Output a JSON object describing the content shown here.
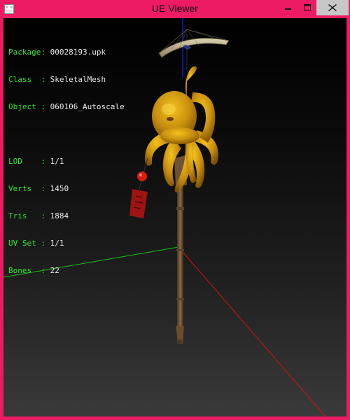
{
  "window": {
    "title": "UE Viewer",
    "frame_color": "#ec1b63"
  },
  "info": {
    "package": {
      "key": "Package",
      "sep": ":",
      "value": "00028193.upk"
    },
    "class": {
      "key": "Class  ",
      "sep": ":",
      "value": "SkeletalMesh"
    },
    "object": {
      "key": "Object ",
      "sep": ":",
      "value": "060106_Autoscale"
    },
    "lod": {
      "key": "LOD    ",
      "sep": ":",
      "value": "1/1"
    },
    "verts": {
      "key": "Verts  ",
      "sep": ":",
      "value": "1450"
    },
    "tris": {
      "key": "Tris   ",
      "sep": ":",
      "value": "1884"
    },
    "uvset": {
      "key": "UV Set ",
      "sep": ":",
      "value": "1/1"
    },
    "bones": {
      "key": "Bones  ",
      "sep": ":",
      "value": "22"
    }
  },
  "colors": {
    "label_green": "#2ee62e",
    "axis_x": "#d01515",
    "axis_y": "#1b8f1b",
    "axis_z": "#2020ff",
    "octopus": "#c98f0f"
  }
}
